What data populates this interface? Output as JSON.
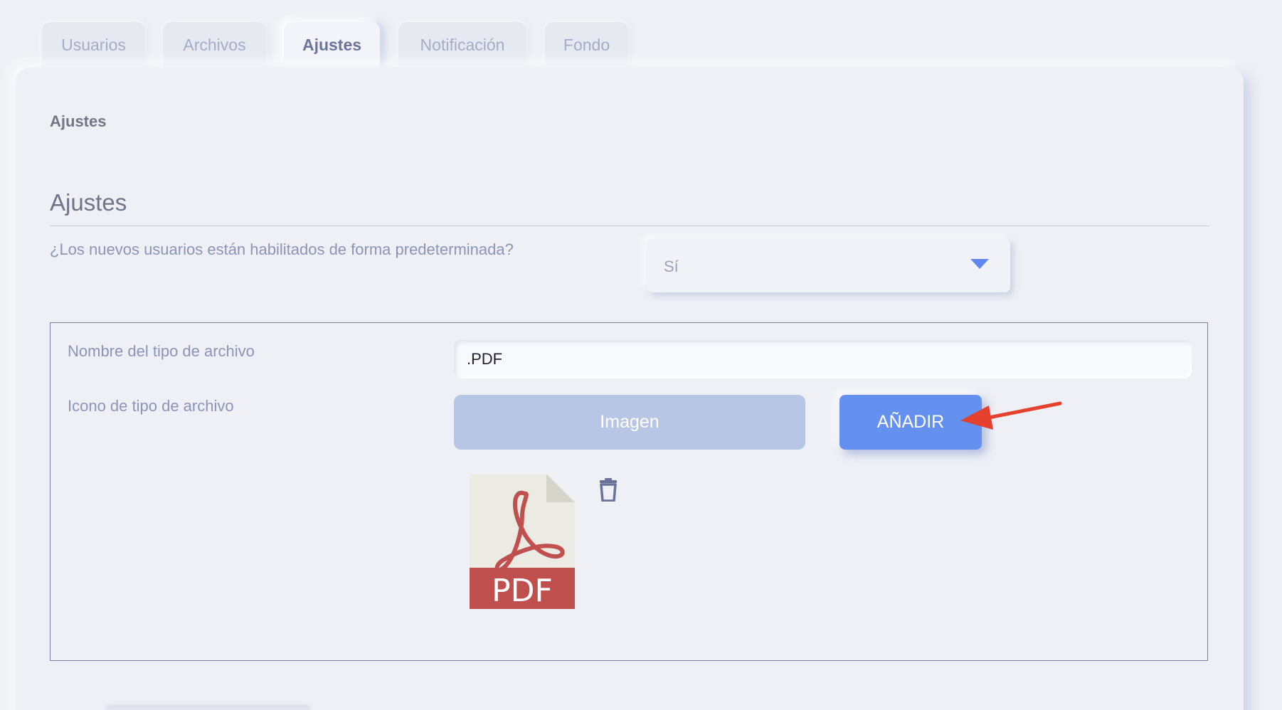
{
  "tabs": [
    {
      "label": "Usuarios",
      "active": false
    },
    {
      "label": "Archivos",
      "active": false
    },
    {
      "label": "Ajustes",
      "active": true
    },
    {
      "label": "Notificación",
      "active": false
    },
    {
      "label": "Fondo",
      "active": false
    }
  ],
  "card": {
    "caption": "Ajustes",
    "section_title": "Ajustes"
  },
  "settings": {
    "new_users_question": "¿Los nuevos usuarios están habilitados de forma predeterminada?",
    "new_users_value": "Sí"
  },
  "filetype": {
    "name_label": "Nombre del tipo de archivo",
    "name_value": ".PDF",
    "icon_label": "Icono de tipo de archivo",
    "image_button": "Imagen",
    "add_button": "AÑADIR",
    "preview_text": "PDF"
  },
  "colors": {
    "accent": "#6491f0",
    "secondary_button": "#b8c6e5",
    "pdf_red": "#c0504e",
    "annotation_arrow": "#e5412d"
  }
}
